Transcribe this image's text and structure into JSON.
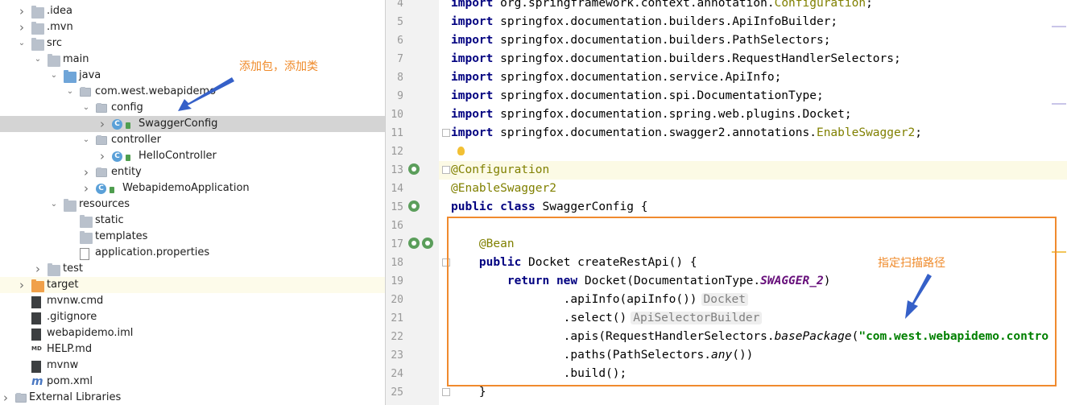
{
  "project_tree": {
    "items": [
      {
        "label": ".idea",
        "indent": 1,
        "arrow": "right",
        "icon": "folder"
      },
      {
        "label": ".mvn",
        "indent": 1,
        "arrow": "right",
        "icon": "folder"
      },
      {
        "label": "src",
        "indent": 1,
        "arrow": "down",
        "icon": "folder"
      },
      {
        "label": "main",
        "indent": 2,
        "arrow": "down",
        "icon": "folder"
      },
      {
        "label": "java",
        "indent": 3,
        "arrow": "down",
        "icon": "folder-blue"
      },
      {
        "label": "com.west.webapidemo",
        "indent": 4,
        "arrow": "down",
        "icon": "package"
      },
      {
        "label": "config",
        "indent": 5,
        "arrow": "down",
        "icon": "package"
      },
      {
        "label": "SwaggerConfig",
        "indent": 6,
        "arrow": "right",
        "icon": "class"
      },
      {
        "label": "controller",
        "indent": 5,
        "arrow": "down",
        "icon": "package"
      },
      {
        "label": "HelloController",
        "indent": 6,
        "arrow": "right",
        "icon": "class"
      },
      {
        "label": "entity",
        "indent": 5,
        "arrow": "right",
        "icon": "package"
      },
      {
        "label": "WebapidemoApplication",
        "indent": 5,
        "arrow": "right",
        "icon": "spring-class"
      },
      {
        "label": "resources",
        "indent": 3,
        "arrow": "down",
        "icon": "resources-folder"
      },
      {
        "label": "static",
        "indent": 4,
        "arrow": "none",
        "icon": "folder"
      },
      {
        "label": "templates",
        "indent": 4,
        "arrow": "none",
        "icon": "folder"
      },
      {
        "label": "application.properties",
        "indent": 4,
        "arrow": "none",
        "icon": "properties-file"
      },
      {
        "label": "test",
        "indent": 2,
        "arrow": "right",
        "icon": "folder"
      },
      {
        "label": "target",
        "indent": 1,
        "arrow": "right",
        "icon": "folder-orange"
      },
      {
        "label": "mvnw.cmd",
        "indent": 1,
        "arrow": "none",
        "icon": "file"
      },
      {
        "label": ".gitignore",
        "indent": 1,
        "arrow": "none",
        "icon": "file"
      },
      {
        "label": "webapidemo.iml",
        "indent": 1,
        "arrow": "none",
        "icon": "file"
      },
      {
        "label": "HELP.md",
        "indent": 1,
        "arrow": "none",
        "icon": "md-file"
      },
      {
        "label": "mvnw",
        "indent": 1,
        "arrow": "none",
        "icon": "file"
      },
      {
        "label": "pom.xml",
        "indent": 1,
        "arrow": "none",
        "icon": "maven-file"
      },
      {
        "label": "External Libraries",
        "indent": 0,
        "arrow": "right",
        "icon": "libraries"
      }
    ],
    "selected": "SwaggerConfig",
    "annotation": "添加包，添加类"
  },
  "editor": {
    "current_line": 13,
    "annotation": "指定扫描路径",
    "lines": [
      {
        "n": "4",
        "segments": [
          {
            "t": "import",
            "c": "kw"
          },
          {
            "t": " org.springframework.context.annotation."
          },
          {
            "t": "Configuration",
            "c": "pkg-hl"
          },
          {
            "t": ";"
          }
        ]
      },
      {
        "n": "5",
        "segments": [
          {
            "t": "import",
            "c": "kw"
          },
          {
            "t": " springfox.documentation.builders.ApiInfoBuilder;"
          }
        ]
      },
      {
        "n": "6",
        "segments": [
          {
            "t": "import",
            "c": "kw"
          },
          {
            "t": " springfox.documentation.builders.PathSelectors;"
          }
        ]
      },
      {
        "n": "7",
        "segments": [
          {
            "t": "import",
            "c": "kw"
          },
          {
            "t": " springfox.documentation.builders.RequestHandlerSelectors;"
          }
        ]
      },
      {
        "n": "8",
        "segments": [
          {
            "t": "import",
            "c": "kw"
          },
          {
            "t": " springfox.documentation.service.ApiInfo;"
          }
        ]
      },
      {
        "n": "9",
        "segments": [
          {
            "t": "import",
            "c": "kw"
          },
          {
            "t": " springfox.documentation.spi.DocumentationType;"
          }
        ]
      },
      {
        "n": "10",
        "segments": [
          {
            "t": "import",
            "c": "kw"
          },
          {
            "t": " springfox.documentation.spring.web.plugins.Docket;"
          }
        ]
      },
      {
        "n": "11",
        "segments": [
          {
            "t": "import",
            "c": "kw"
          },
          {
            "t": " springfox.documentation.swagger2.annotations."
          },
          {
            "t": "EnableSwagger2",
            "c": "pkg-hl"
          },
          {
            "t": ";"
          }
        ]
      },
      {
        "n": "12",
        "segments": []
      },
      {
        "n": "13",
        "segments": [
          {
            "t": "@Configuration",
            "c": "an"
          }
        ]
      },
      {
        "n": "14",
        "segments": [
          {
            "t": "@EnableSwagger2",
            "c": "an"
          }
        ]
      },
      {
        "n": "15",
        "segments": [
          {
            "t": "public class",
            "c": "kw"
          },
          {
            "t": " SwaggerConfig {"
          }
        ]
      },
      {
        "n": "16",
        "segments": []
      },
      {
        "n": "17",
        "segments": [
          {
            "t": "    "
          },
          {
            "t": "@Bean",
            "c": "an"
          }
        ]
      },
      {
        "n": "18",
        "segments": [
          {
            "t": "    "
          },
          {
            "t": "public",
            "c": "kw"
          },
          {
            "t": " Docket createRestApi() {"
          }
        ]
      },
      {
        "n": "19",
        "segments": [
          {
            "t": "        "
          },
          {
            "t": "return new",
            "c": "kw"
          },
          {
            "t": " Docket(DocumentationType."
          },
          {
            "t": "SWAGGER_2",
            "c": "ital-field"
          },
          {
            "t": ")"
          }
        ]
      },
      {
        "n": "20",
        "segments": [
          {
            "t": "                .apiInfo(apiInfo())"
          },
          {
            "t": "Docket",
            "c": "hint"
          }
        ]
      },
      {
        "n": "21",
        "segments": [
          {
            "t": "                .select()"
          },
          {
            "t": "ApiSelectorBuilder",
            "c": "hint"
          }
        ]
      },
      {
        "n": "22",
        "segments": [
          {
            "t": "                .apis(RequestHandlerSelectors."
          },
          {
            "t": "basePackage",
            "c": "it"
          },
          {
            "t": "("
          },
          {
            "t": "\"com.west.webapidemo.contro",
            "c": "str"
          }
        ]
      },
      {
        "n": "23",
        "segments": [
          {
            "t": "                .paths(PathSelectors."
          },
          {
            "t": "any",
            "c": "it"
          },
          {
            "t": "())"
          }
        ]
      },
      {
        "n": "24",
        "segments": [
          {
            "t": "                .build();"
          }
        ]
      },
      {
        "n": "25",
        "segments": [
          {
            "t": "    }"
          }
        ]
      }
    ]
  }
}
